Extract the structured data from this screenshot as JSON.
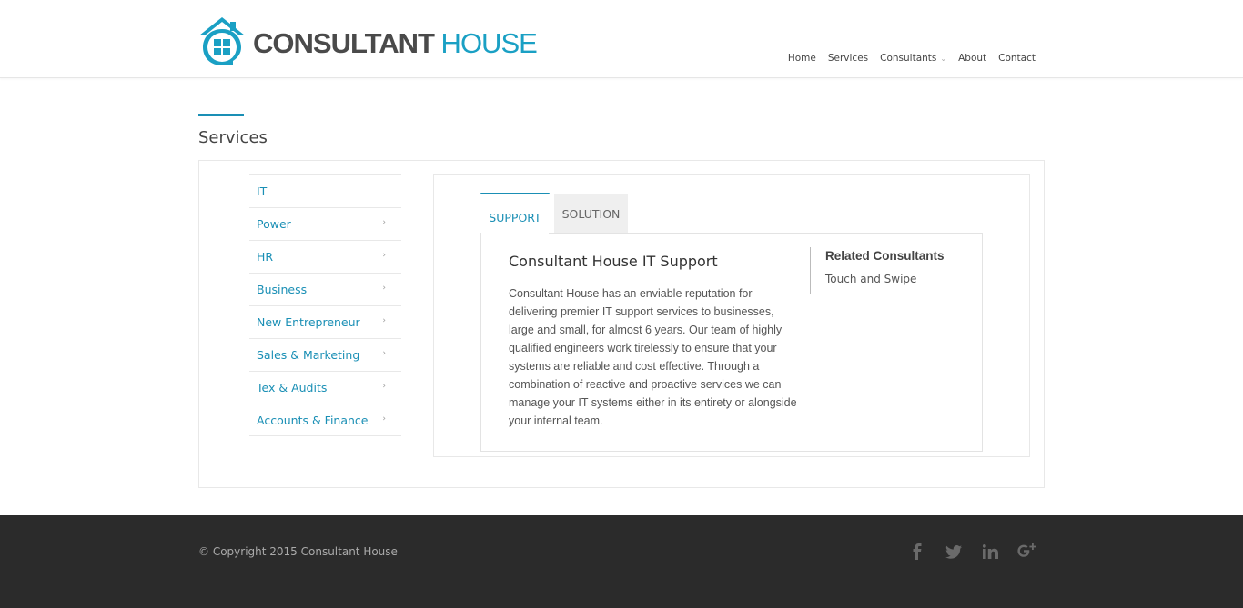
{
  "logo": {
    "word1": "CONSULTANT",
    "word2": " HOUSE",
    "icon": "house-logo-icon",
    "brand_color": "#1aa0c4"
  },
  "nav": {
    "items": [
      {
        "label": "Home"
      },
      {
        "label": "Services"
      },
      {
        "label": "Consultants",
        "has_dropdown": true
      },
      {
        "label": "About"
      },
      {
        "label": "Contact"
      }
    ]
  },
  "page": {
    "title": "Services"
  },
  "sidebar": {
    "items": [
      {
        "label": "IT",
        "active": true
      },
      {
        "label": "Power"
      },
      {
        "label": "HR"
      },
      {
        "label": "Business"
      },
      {
        "label": "New Entrepreneur"
      },
      {
        "label": "Sales & Marketing"
      },
      {
        "label": "Tex & Audits"
      },
      {
        "label": "Accounts & Finance"
      }
    ]
  },
  "tabs": {
    "items": [
      {
        "label": "SUPPORT",
        "active": true
      },
      {
        "label": "SOLUTION"
      }
    ]
  },
  "article": {
    "title": "Consultant House IT Support",
    "body": "Consultant House has an enviable reputation for delivering premier IT support services to businesses, large and small, for almost 6 years.  Our team of highly qualified engineers work tirelessly to ensure that your systems are reliable and cost effective.  Through a combination of reactive and proactive services we can manage your IT systems either in its entirety or alongside your internal team."
  },
  "related": {
    "title": "Related Consultants",
    "link": "Touch and Swipe"
  },
  "footer": {
    "copyright": "© Copyright 2015 Consultant House",
    "social": [
      "facebook-icon",
      "twitter-icon",
      "linkedin-icon",
      "google-plus-icon"
    ]
  },
  "colors": {
    "accent": "#1a8fb5",
    "footer_bg": "#2b2b2b"
  }
}
